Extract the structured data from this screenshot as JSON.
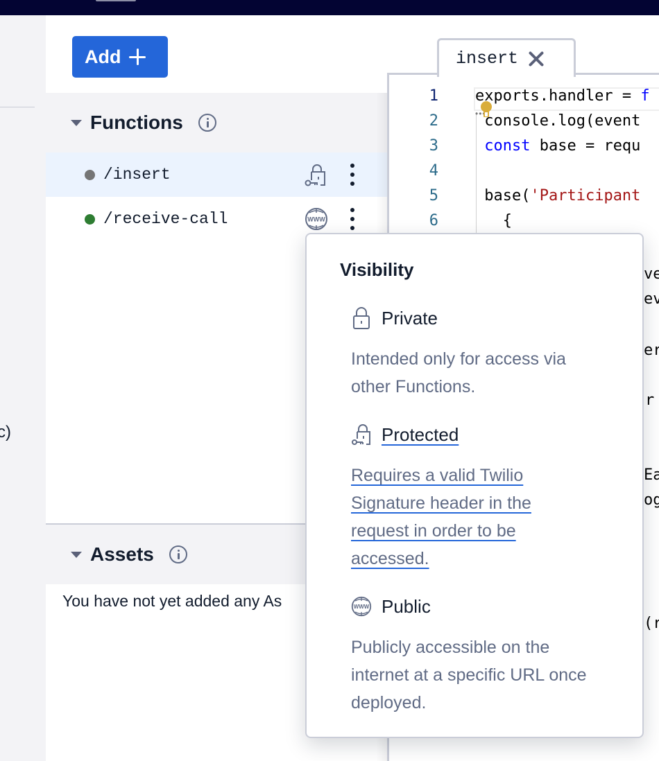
{
  "topbar": {},
  "left_rail": {
    "cut_text": "c)"
  },
  "sidebar": {
    "add_button_label": "Add",
    "functions": {
      "title": "Functions",
      "items": [
        {
          "path": "/insert",
          "status_color": "#757575",
          "visibility": "protected",
          "selected": true
        },
        {
          "path": "/receive-call",
          "status_color": "#2e7d32",
          "visibility": "public",
          "selected": false
        }
      ]
    },
    "assets": {
      "title": "Assets",
      "empty_text": "You have not yet added any As"
    }
  },
  "editor": {
    "tab_label": "insert",
    "lines": [
      {
        "n": "1",
        "parts": [
          {
            "t": "exports.handler = ",
            "c": "plain"
          },
          {
            "t": "f",
            "c": "kw"
          }
        ]
      },
      {
        "n": "2",
        "parts": [
          {
            "t": " console.log(event",
            "c": "plain"
          }
        ]
      },
      {
        "n": "3",
        "parts": [
          {
            "t": " ",
            "c": "plain"
          },
          {
            "t": "const",
            "c": "kw"
          },
          {
            "t": " base = requ",
            "c": "plain"
          }
        ]
      },
      {
        "n": "4",
        "parts": []
      },
      {
        "n": "5",
        "parts": [
          {
            "t": " base(",
            "c": "plain"
          },
          {
            "t": "'Participant",
            "c": "str"
          }
        ]
      },
      {
        "n": "6",
        "parts": [
          {
            "t": "   {",
            "c": "plain"
          }
        ]
      }
    ],
    "peek_fragments": [
      "ve",
      "ev",
      "er",
      "r",
      "Ea",
      "og",
      "(r"
    ]
  },
  "visibility_popover": {
    "title": "Visibility",
    "options": [
      {
        "icon": "lock-icon",
        "label": "Private",
        "description": "Intended only for access via other Functions.",
        "linked": false
      },
      {
        "icon": "lock-key-icon",
        "label": "Protected",
        "description": "Requires a valid Twilio Signature header in the request in order to be accessed.",
        "linked": true
      },
      {
        "icon": "globe-www-icon",
        "label": "Public",
        "description": "Publicly accessible on the internet at a specific URL once deployed.",
        "linked": false
      }
    ]
  },
  "colors": {
    "brand_blue": "#2466d9",
    "topbar": "#030433",
    "text_primary": "#121c2d",
    "text_secondary": "#606b85",
    "selected_row": "#ebf3fe"
  }
}
